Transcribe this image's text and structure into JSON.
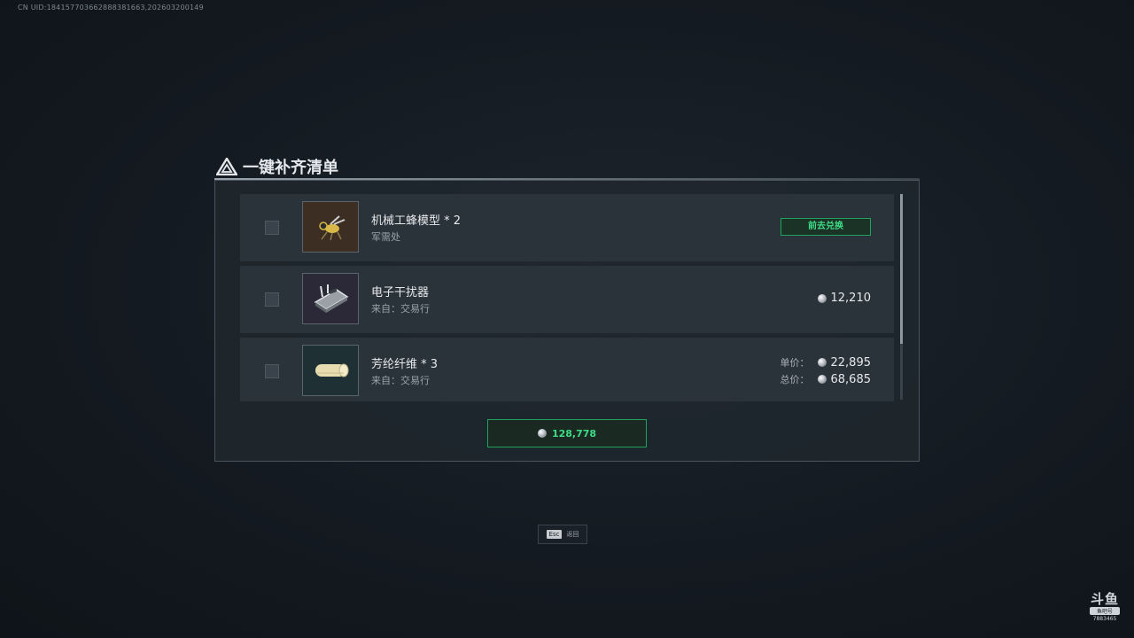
{
  "uid_text": "CN UID:1841577036628883816​63,202603200149",
  "dialog": {
    "title": "一键补齐清单",
    "items": [
      {
        "name": "机械工蜂模型 * 2",
        "source": "军需处",
        "action_label": "前去兑换"
      },
      {
        "name": "电子干扰器",
        "source": "来自：交易行",
        "price": "12,210"
      },
      {
        "name": "芳纶纤维 * 3",
        "source": "来自：交易行",
        "unit_label": "单价：",
        "unit_price": "22,895",
        "total_label": "总价：",
        "total_price": "68,685"
      }
    ],
    "total": "128,778",
    "scroll_fraction": 0.73
  },
  "esc_hint": {
    "key": "Esc",
    "label": "返回"
  },
  "watermark": {
    "logo": "斗鱼",
    "tag": "鱼吧号",
    "id": "7883465"
  },
  "colors": {
    "accent_green": "#3ddc84",
    "panel": "#1f272e",
    "row": "#2a323a"
  }
}
